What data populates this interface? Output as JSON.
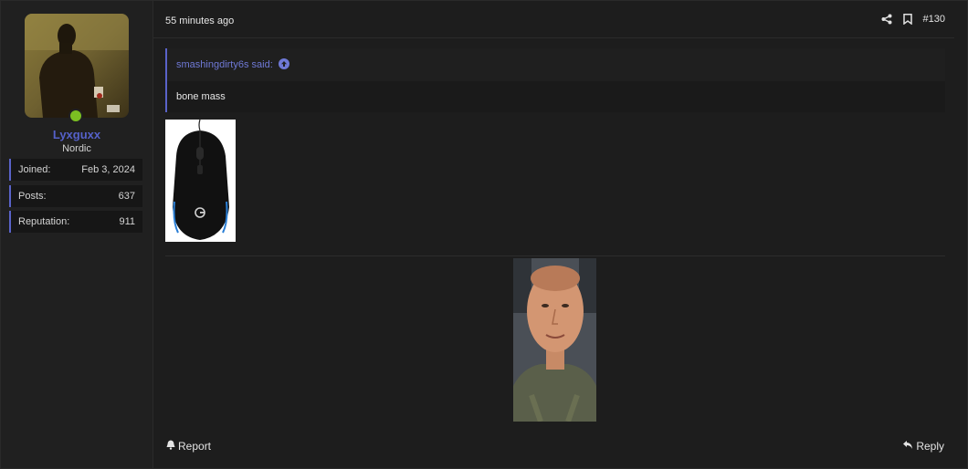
{
  "user": {
    "name": "Lyxguxx",
    "title": "Nordic",
    "online_color": "#7bbf22",
    "stats": [
      {
        "label": "Joined:",
        "value": "Feb 3, 2024"
      },
      {
        "label": "Posts:",
        "value": "637"
      },
      {
        "label": "Reputation:",
        "value": "911"
      }
    ]
  },
  "post": {
    "time": "55 minutes ago",
    "number": "#130",
    "quote": {
      "author": "smashingdirty6s said:",
      "text": "bone mass"
    },
    "images": [
      "gaming-mouse-image",
      "man-portrait-image"
    ]
  },
  "actions": {
    "report": "Report",
    "reply": "Reply",
    "share_icon": "share-icon",
    "bookmark_icon": "bookmark-icon"
  },
  "colors": {
    "accent": "#5a63c9",
    "username": "#5561c9",
    "background": "#1d1d1d"
  }
}
